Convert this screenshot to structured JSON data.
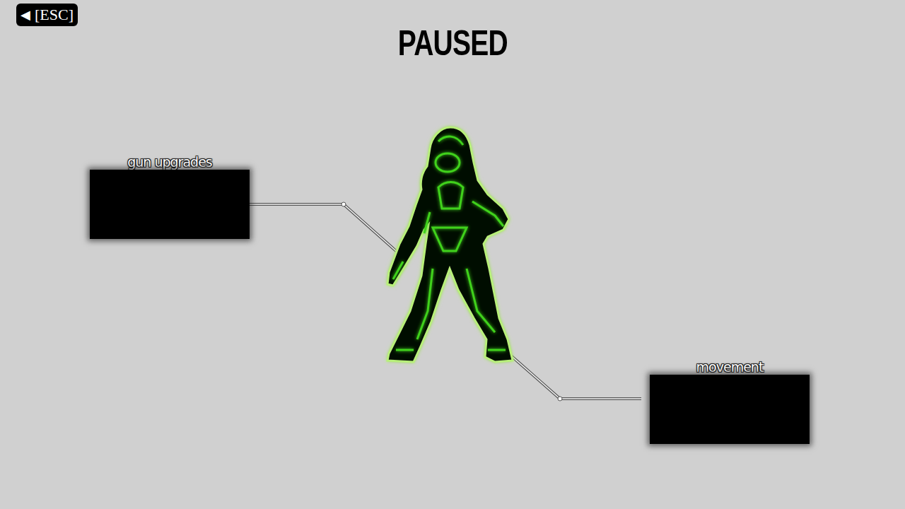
{
  "back_button": {
    "icon": "◀",
    "label": "[ESC]"
  },
  "title": "PAUSED",
  "panels": [
    {
      "label": "gun upgrades"
    },
    {
      "label": "movement"
    }
  ]
}
